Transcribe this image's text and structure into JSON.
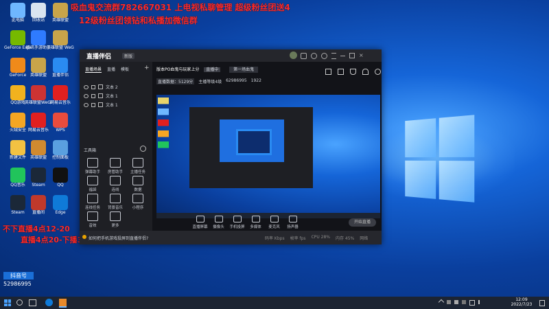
{
  "overlay": {
    "line1": "吸血鬼交流群782667031  上电视私聊管理  超级粉丝团送4",
    "line2": "12级粉丝团领钻和私播加微信群",
    "bottom1": "不下直播4点12-20",
    "bottom2": "直播4点20-下播3"
  },
  "desktop_icons": [
    {
      "label": "此电脑",
      "color": "#6fb7ff"
    },
    {
      "label": "回收站",
      "color": "#d9e4f0"
    },
    {
      "label": "英雄联盟",
      "color": "#c8a44a"
    },
    {
      "label": "GeForce Experience",
      "color": "#76b900"
    },
    {
      "label": "腾讯手游助手",
      "color": "#2f7bff"
    },
    {
      "label": "英雄联盟 WeGame",
      "color": "#c8a44a"
    },
    {
      "label": "GeForce",
      "color": "#f08a1a"
    },
    {
      "label": "英雄联盟",
      "color": "#c8a44a"
    },
    {
      "label": "直播伴侣",
      "color": "#2a8bf2"
    },
    {
      "label": "QQ游戏",
      "color": "#f2b21e"
    },
    {
      "label": "英雄联盟WeGame版",
      "color": "#c33"
    },
    {
      "label": "网易云音乐",
      "color": "#e02020"
    },
    {
      "label": "火绒安全",
      "color": "#f5a623"
    },
    {
      "label": "网易云音乐",
      "color": "#e02020"
    },
    {
      "label": "WPS",
      "color": "#e84c3d"
    },
    {
      "label": "新建文件",
      "color": "#f3c242"
    },
    {
      "label": "英雄联盟",
      "color": "#d08a30"
    },
    {
      "label": "控制面板",
      "color": "#5aa0e0"
    },
    {
      "label": "QQ音乐",
      "color": "#21c45b"
    },
    {
      "label": "Steam",
      "color": "#1b2838"
    },
    {
      "label": "QQ",
      "color": "#111"
    },
    {
      "label": "Steam",
      "color": "#1b2838"
    },
    {
      "label": "直播间",
      "color": "#c0392b"
    },
    {
      "label": "Edge",
      "color": "#0f7ad8"
    }
  ],
  "badge": {
    "brand": "抖音号",
    "number": "52986995"
  },
  "app": {
    "logo": "直播伴侣",
    "version": "新版",
    "tabs": [
      "直播场景",
      "直播",
      "模板"
    ],
    "layers": [
      "文本 2",
      "文本 1",
      "文本 1"
    ],
    "tools_title": "工具箱",
    "tools": [
      "弹幕助手",
      "房管助手",
      "主播任务",
      "福袋",
      "连线",
      "数据",
      "连线任务",
      "背景音乐",
      "小程序",
      "音效",
      "更多"
    ],
    "room_title": "版本PO血鬼与玩家上分",
    "room_tag": "直播中",
    "room_button": "第一场血鬼",
    "stats": [
      "直播数据：5129分",
      "主播等级4级",
      "62986995",
      "1922"
    ],
    "bottom_tools": [
      "直播屏幕",
      "摄像头",
      "手机投屏",
      "多媒体",
      "麦克风",
      "扬声器"
    ],
    "start_button": "开始直播",
    "notice": "如何把手机游戏投屏到直播伴侣?",
    "status": [
      "码率 Kbps",
      "帧率 fps",
      "CPU 28%",
      "内存 45%",
      "网络"
    ]
  },
  "clock": {
    "time": "12:09",
    "date": "2022/7/23"
  }
}
